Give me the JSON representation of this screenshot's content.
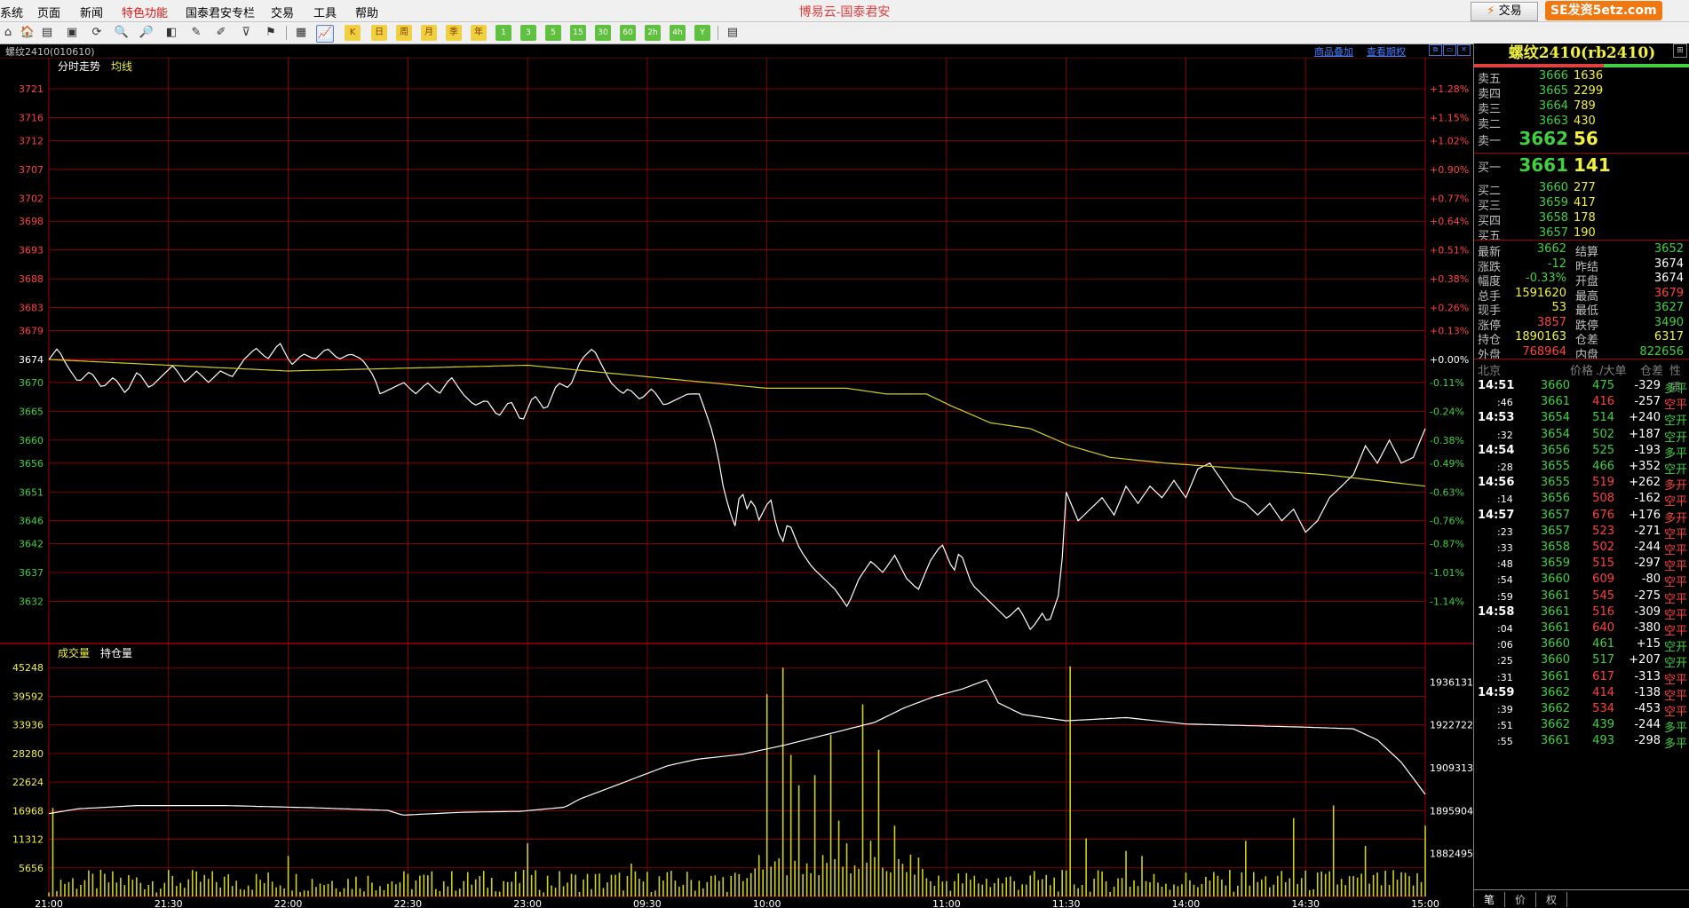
{
  "menu": {
    "items": [
      "系统",
      "页面",
      "新闻",
      "特色功能",
      "国泰君安专栏",
      "交易",
      "工具",
      "帮助"
    ],
    "active_index": 3,
    "app_title": "博易云-国泰君安",
    "trade_button": "交易",
    "site_tag": "SE发资5etz.com"
  },
  "toolbar": {
    "periods": [
      "日",
      "周",
      "月",
      "季",
      "年"
    ],
    "minutes": [
      "1",
      "3",
      "5",
      "15",
      "30",
      "60",
      "2h",
      "4h",
      "Y"
    ]
  },
  "chart": {
    "symbol_label": "螺纹2410(010610)",
    "links": [
      "商品叠加",
      "查看期权"
    ],
    "price_panel": {
      "tab1": "分时走势",
      "tab2": "均线"
    },
    "volume_panel": {
      "tab1": "成交量",
      "tab2": "持仓量"
    },
    "colors": {
      "up": "#ff4040",
      "down": "#40d040",
      "price_line": "#ffffff",
      "avg_line": "#d0d020",
      "grid": "#a00000",
      "volume": "#d0d020"
    }
  },
  "chart_data": {
    "type": "line",
    "price_axis": {
      "ticks": [
        3721,
        3716,
        3712,
        3707,
        3702,
        3698,
        3693,
        3688,
        3683,
        3679,
        3674,
        3670,
        3665,
        3660,
        3656,
        3651,
        3646,
        3642,
        3637,
        3632
      ],
      "pct_ticks": [
        "+1.28%",
        "+1.15%",
        "+1.02%",
        "+0.90%",
        "+0.77%",
        "+0.64%",
        "+0.51%",
        "+0.38%",
        "+0.26%",
        "+0.13%",
        "+0.00%",
        "-0.11%",
        "-0.24%",
        "-0.38%",
        "-0.49%",
        "-0.63%",
        "-0.76%",
        "-0.87%",
        "-1.01%",
        "-1.14%"
      ],
      "ylim": [
        3627,
        3723
      ]
    },
    "volume_axis": {
      "ticks": [
        45248,
        39592,
        33936,
        28280,
        22624,
        16968,
        11312,
        5656
      ],
      "ylim": [
        0,
        50904
      ]
    },
    "oi_axis": {
      "ticks": [
        1936131,
        1922722,
        1909313,
        1895904,
        1882495
      ],
      "ylim": [
        1869086,
        1949540
      ]
    },
    "time_labels": [
      "21:00",
      "21:30",
      "22:00",
      "22:30",
      "23:00",
      "09:30",
      "10:00",
      "11:00",
      "11:30",
      "14:00",
      "14:30",
      "15:00"
    ],
    "time_label_index": [
      0,
      30,
      60,
      90,
      120,
      150,
      180,
      225,
      255,
      285,
      315,
      345
    ],
    "total_points": 346,
    "price_series": {
      "name": "分时走势",
      "keypoints": [
        [
          0,
          3674
        ],
        [
          3,
          3676
        ],
        [
          6,
          3673
        ],
        [
          10,
          3670
        ],
        [
          14,
          3672
        ],
        [
          18,
          3669
        ],
        [
          22,
          3671
        ],
        [
          26,
          3668
        ],
        [
          30,
          3672
        ],
        [
          34,
          3669
        ],
        [
          38,
          3671
        ],
        [
          42,
          3673
        ],
        [
          46,
          3670
        ],
        [
          50,
          3672
        ],
        [
          54,
          3670
        ],
        [
          58,
          3672
        ],
        [
          62,
          3671
        ],
        [
          66,
          3674
        ],
        [
          70,
          3676
        ],
        [
          74,
          3674
        ],
        [
          78,
          3677
        ],
        [
          82,
          3673
        ],
        [
          86,
          3675
        ],
        [
          90,
          3674
        ],
        [
          94,
          3676
        ],
        [
          98,
          3674
        ],
        [
          102,
          3675
        ],
        [
          106,
          3674
        ],
        [
          110,
          3671
        ],
        [
          112,
          3668
        ],
        [
          116,
          3669
        ],
        [
          120,
          3670
        ],
        [
          124,
          3668
        ],
        [
          128,
          3670
        ],
        [
          132,
          3668
        ],
        [
          136,
          3671
        ],
        [
          140,
          3668
        ],
        [
          144,
          3666
        ],
        [
          148,
          3667
        ],
        [
          152,
          3664
        ],
        [
          156,
          3667
        ],
        [
          160,
          3663
        ],
        [
          164,
          3668
        ],
        [
          168,
          3665
        ],
        [
          172,
          3670
        ],
        [
          176,
          3669
        ],
        [
          180,
          3674
        ],
        [
          184,
          3676
        ],
        [
          188,
          3672
        ],
        [
          190,
          3670
        ],
        [
          194,
          3668
        ],
        [
          196,
          3669
        ],
        [
          200,
          3667
        ],
        [
          204,
          3669
        ],
        [
          208,
          3666
        ],
        [
          212,
          3667
        ],
        [
          216,
          3668
        ],
        [
          220,
          3668
        ],
        [
          224,
          3662
        ],
        [
          226,
          3658
        ],
        [
          228,
          3652
        ],
        [
          230,
          3648
        ],
        [
          232,
          3645
        ],
        [
          234,
          3652
        ],
        [
          236,
          3648
        ],
        [
          238,
          3650
        ],
        [
          240,
          3646
        ],
        [
          244,
          3650
        ],
        [
          246,
          3645
        ],
        [
          248,
          3642
        ],
        [
          250,
          3646
        ],
        [
          254,
          3641
        ],
        [
          258,
          3638
        ],
        [
          262,
          3636
        ],
        [
          266,
          3634
        ],
        [
          270,
          3631
        ],
        [
          274,
          3636
        ],
        [
          278,
          3639
        ],
        [
          282,
          3637
        ],
        [
          286,
          3640
        ],
        [
          290,
          3636
        ],
        [
          294,
          3634
        ],
        [
          298,
          3639
        ],
        [
          302,
          3642
        ],
        [
          306,
          3637
        ],
        [
          308,
          3641
        ],
        [
          312,
          3635
        ],
        [
          316,
          3633
        ],
        [
          320,
          3631
        ],
        [
          324,
          3629
        ],
        [
          328,
          3631
        ],
        [
          332,
          3627
        ],
        [
          336,
          3630
        ],
        [
          338,
          3628
        ],
        [
          342,
          3634
        ],
        [
          344,
          3651
        ]
      ],
      "keypoints_b": [
        [
          0,
          3651
        ],
        [
          4,
          3646
        ],
        [
          8,
          3648
        ],
        [
          12,
          3650
        ],
        [
          16,
          3647
        ],
        [
          20,
          3652
        ],
        [
          24,
          3649
        ],
        [
          28,
          3652
        ],
        [
          32,
          3650
        ],
        [
          36,
          3653
        ],
        [
          40,
          3650
        ],
        [
          44,
          3655
        ],
        [
          48,
          3656
        ],
        [
          52,
          3653
        ],
        [
          56,
          3650
        ],
        [
          60,
          3649
        ],
        [
          64,
          3647
        ],
        [
          68,
          3649
        ],
        [
          72,
          3646
        ],
        [
          76,
          3648
        ],
        [
          80,
          3644
        ],
        [
          84,
          3646
        ],
        [
          88,
          3650
        ],
        [
          92,
          3652
        ],
        [
          96,
          3654
        ],
        [
          100,
          3659
        ],
        [
          104,
          3656
        ],
        [
          108,
          3660
        ],
        [
          112,
          3656
        ],
        [
          116,
          3657
        ],
        [
          120,
          3662
        ]
      ]
    },
    "avg_series": {
      "name": "均线",
      "keypoints": [
        [
          0,
          3674
        ],
        [
          60,
          3672
        ],
        [
          120,
          3673
        ],
        [
          150,
          3671
        ],
        [
          180,
          3669
        ],
        [
          200,
          3669
        ],
        [
          210,
          3668
        ],
        [
          220,
          3668
        ],
        [
          226,
          3666
        ],
        [
          236,
          3663
        ],
        [
          246,
          3662
        ],
        [
          256,
          3659
        ],
        [
          266,
          3657
        ],
        [
          280,
          3656
        ],
        [
          300,
          3655
        ],
        [
          320,
          3654
        ],
        [
          345,
          3652
        ]
      ]
    },
    "oi_series": {
      "name": "持仓量",
      "keypoints": [
        [
          0,
          1895000
        ],
        [
          10,
          1896500
        ],
        [
          30,
          1897500
        ],
        [
          60,
          1897500
        ],
        [
          90,
          1896800
        ],
        [
          115,
          1896000
        ],
        [
          120,
          1894500
        ],
        [
          140,
          1895400
        ],
        [
          160,
          1895700
        ],
        [
          175,
          1897000
        ],
        [
          180,
          1899500
        ],
        [
          190,
          1903000
        ],
        [
          200,
          1906500
        ],
        [
          210,
          1910000
        ],
        [
          220,
          1912000
        ],
        [
          235,
          1913500
        ],
        [
          250,
          1916500
        ],
        [
          265,
          1920000
        ],
        [
          280,
          1923500
        ],
        [
          290,
          1928000
        ],
        [
          300,
          1931500
        ],
        [
          310,
          1934000
        ],
        [
          318,
          1936800
        ],
        [
          322,
          1929600
        ],
        [
          330,
          1926000
        ],
        [
          345,
          1924000
        ]
      ],
      "keypoints_b": [
        [
          0,
          1926000
        ],
        [
          20,
          1925000
        ],
        [
          40,
          1923000
        ],
        [
          60,
          1922500
        ],
        [
          80,
          1922000
        ],
        [
          96,
          1921500
        ],
        [
          104,
          1918000
        ],
        [
          112,
          1911000
        ],
        [
          116,
          1906000
        ],
        [
          120,
          1901000
        ]
      ]
    },
    "volume_spikes": [
      [
        1,
        17500
      ],
      [
        60,
        8000
      ],
      [
        120,
        10500
      ],
      [
        146,
        6500
      ],
      [
        180,
        40000
      ],
      [
        184,
        45248
      ],
      [
        186,
        28000
      ],
      [
        188,
        22000
      ],
      [
        192,
        24000
      ],
      [
        196,
        32000
      ],
      [
        198,
        15000
      ],
      [
        200,
        10500
      ],
      [
        204,
        38000
      ],
      [
        206,
        11000
      ],
      [
        208,
        29000
      ],
      [
        212,
        14000
      ],
      [
        256,
        45500
      ],
      [
        260,
        11500
      ],
      [
        270,
        9000
      ],
      [
        274,
        8000
      ],
      [
        300,
        11000
      ],
      [
        312,
        15500
      ],
      [
        322,
        18000
      ],
      [
        330,
        10000
      ],
      [
        345,
        14000
      ]
    ]
  },
  "quote": {
    "title": "螺纹2410(rb2410)",
    "asks": [
      {
        "label": "卖五",
        "price": "3666",
        "vol": "1636"
      },
      {
        "label": "卖四",
        "price": "3665",
        "vol": "2299"
      },
      {
        "label": "卖三",
        "price": "3664",
        "vol": "789"
      },
      {
        "label": "卖二",
        "price": "3663",
        "vol": "430"
      },
      {
        "label": "卖一",
        "price": "3662",
        "vol": "56"
      }
    ],
    "bids": [
      {
        "label": "买一",
        "price": "3661",
        "vol": "141"
      },
      {
        "label": "买二",
        "price": "3660",
        "vol": "277"
      },
      {
        "label": "买三",
        "price": "3659",
        "vol": "417"
      },
      {
        "label": "买四",
        "price": "3658",
        "vol": "178"
      },
      {
        "label": "买五",
        "price": "3657",
        "vol": "190"
      }
    ],
    "stats": [
      {
        "l1": "最新",
        "v1": "3662",
        "c1": "#40d040",
        "l2": "结算",
        "v2": "3652",
        "c2": "#40d040"
      },
      {
        "l1": "涨跌",
        "v1": "-12",
        "c1": "#40d040",
        "l2": "昨结",
        "v2": "3674",
        "c2": "#ffffff"
      },
      {
        "l1": "幅度",
        "v1": "-0.33%",
        "c1": "#40d040",
        "l2": "开盘",
        "v2": "3674",
        "c2": "#ffffff"
      },
      {
        "l1": "总手",
        "v1": "1591620",
        "c1": "#f0f040",
        "l2": "最高",
        "v2": "3679",
        "c2": "#ff4040"
      },
      {
        "l1": "现手",
        "v1": "53",
        "c1": "#f0f040",
        "l2": "最低",
        "v2": "3627",
        "c2": "#40d040"
      },
      {
        "l1": "涨停",
        "v1": "3857",
        "c1": "#ff4040",
        "l2": "跌停",
        "v2": "3490",
        "c2": "#40d040"
      },
      {
        "l1": "持仓",
        "v1": "1890163",
        "c1": "#f0f040",
        "l2": "仓差",
        "v2": "6317",
        "c2": "#f0f040"
      },
      {
        "l1": "外盘",
        "v1": "768964",
        "c1": "#ff4040",
        "l2": "内盘",
        "v2": "822656",
        "c2": "#40d040"
      }
    ],
    "tick_header": [
      "北京",
      "价格",
      "./大单",
      "仓差",
      "性质"
    ],
    "ticks": [
      {
        "time": "14:51",
        "major": true,
        "price": "3660",
        "vol": "475",
        "oi": "-329",
        "nature": "多平",
        "c": "#40d040"
      },
      {
        "time": ":46",
        "major": false,
        "price": "3661",
        "vol": "416",
        "oi": "-257",
        "nature": "空平",
        "c": "#ff4040"
      },
      {
        "time": "14:53",
        "major": true,
        "price": "3654",
        "vol": "514",
        "oi": "+240",
        "nature": "空开",
        "c": "#40d040"
      },
      {
        "time": ":32",
        "major": false,
        "price": "3654",
        "vol": "502",
        "oi": "+187",
        "nature": "空开",
        "c": "#40d040"
      },
      {
        "time": "14:54",
        "major": true,
        "price": "3656",
        "vol": "525",
        "oi": "-193",
        "nature": "多平",
        "c": "#40d040"
      },
      {
        "time": ":28",
        "major": false,
        "price": "3655",
        "vol": "466",
        "oi": "+352",
        "nature": "空开",
        "c": "#40d040"
      },
      {
        "time": "14:56",
        "major": true,
        "price": "3655",
        "vol": "519",
        "oi": "+262",
        "nature": "多开",
        "c": "#ff4040"
      },
      {
        "time": ":14",
        "major": false,
        "price": "3656",
        "vol": "508",
        "oi": "-162",
        "nature": "空平",
        "c": "#ff4040"
      },
      {
        "time": "14:57",
        "major": true,
        "price": "3657",
        "vol": "676",
        "oi": "+176",
        "nature": "多开",
        "c": "#ff4040"
      },
      {
        "time": ":23",
        "major": false,
        "price": "3657",
        "vol": "523",
        "oi": "-271",
        "nature": "空平",
        "c": "#ff4040"
      },
      {
        "time": ":33",
        "major": false,
        "price": "3658",
        "vol": "502",
        "oi": "-244",
        "nature": "空平",
        "c": "#ff4040"
      },
      {
        "time": ":48",
        "major": false,
        "price": "3659",
        "vol": "515",
        "oi": "-297",
        "nature": "空平",
        "c": "#ff4040"
      },
      {
        "time": ":54",
        "major": false,
        "price": "3660",
        "vol": "609",
        "oi": "-80",
        "nature": "空平",
        "c": "#ff4040"
      },
      {
        "time": ":59",
        "major": false,
        "price": "3661",
        "vol": "545",
        "oi": "-275",
        "nature": "空平",
        "c": "#ff4040"
      },
      {
        "time": "14:58",
        "major": true,
        "price": "3661",
        "vol": "516",
        "oi": "-309",
        "nature": "空平",
        "c": "#ff4040"
      },
      {
        "time": ":04",
        "major": false,
        "price": "3661",
        "vol": "640",
        "oi": "-380",
        "nature": "空平",
        "c": "#ff4040"
      },
      {
        "time": ":06",
        "major": false,
        "price": "3660",
        "vol": "461",
        "oi": "+15",
        "nature": "空开",
        "c": "#40d040"
      },
      {
        "time": ":25",
        "major": false,
        "price": "3660",
        "vol": "517",
        "oi": "+207",
        "nature": "空开",
        "c": "#40d040"
      },
      {
        "time": ":31",
        "major": false,
        "price": "3661",
        "vol": "617",
        "oi": "-313",
        "nature": "空平",
        "c": "#ff4040"
      },
      {
        "time": "14:59",
        "major": true,
        "price": "3662",
        "vol": "414",
        "oi": "-138",
        "nature": "空平",
        "c": "#ff4040"
      },
      {
        "time": ":39",
        "major": false,
        "price": "3662",
        "vol": "534",
        "oi": "-453",
        "nature": "空平",
        "c": "#ff4040"
      },
      {
        "time": ":51",
        "major": false,
        "price": "3662",
        "vol": "439",
        "oi": "-244",
        "nature": "多平",
        "c": "#40d040"
      },
      {
        "time": ":55",
        "major": false,
        "price": "3661",
        "vol": "493",
        "oi": "-298",
        "nature": "多平",
        "c": "#40d040"
      }
    ],
    "tabs": [
      "笔",
      "价",
      "权"
    ]
  }
}
